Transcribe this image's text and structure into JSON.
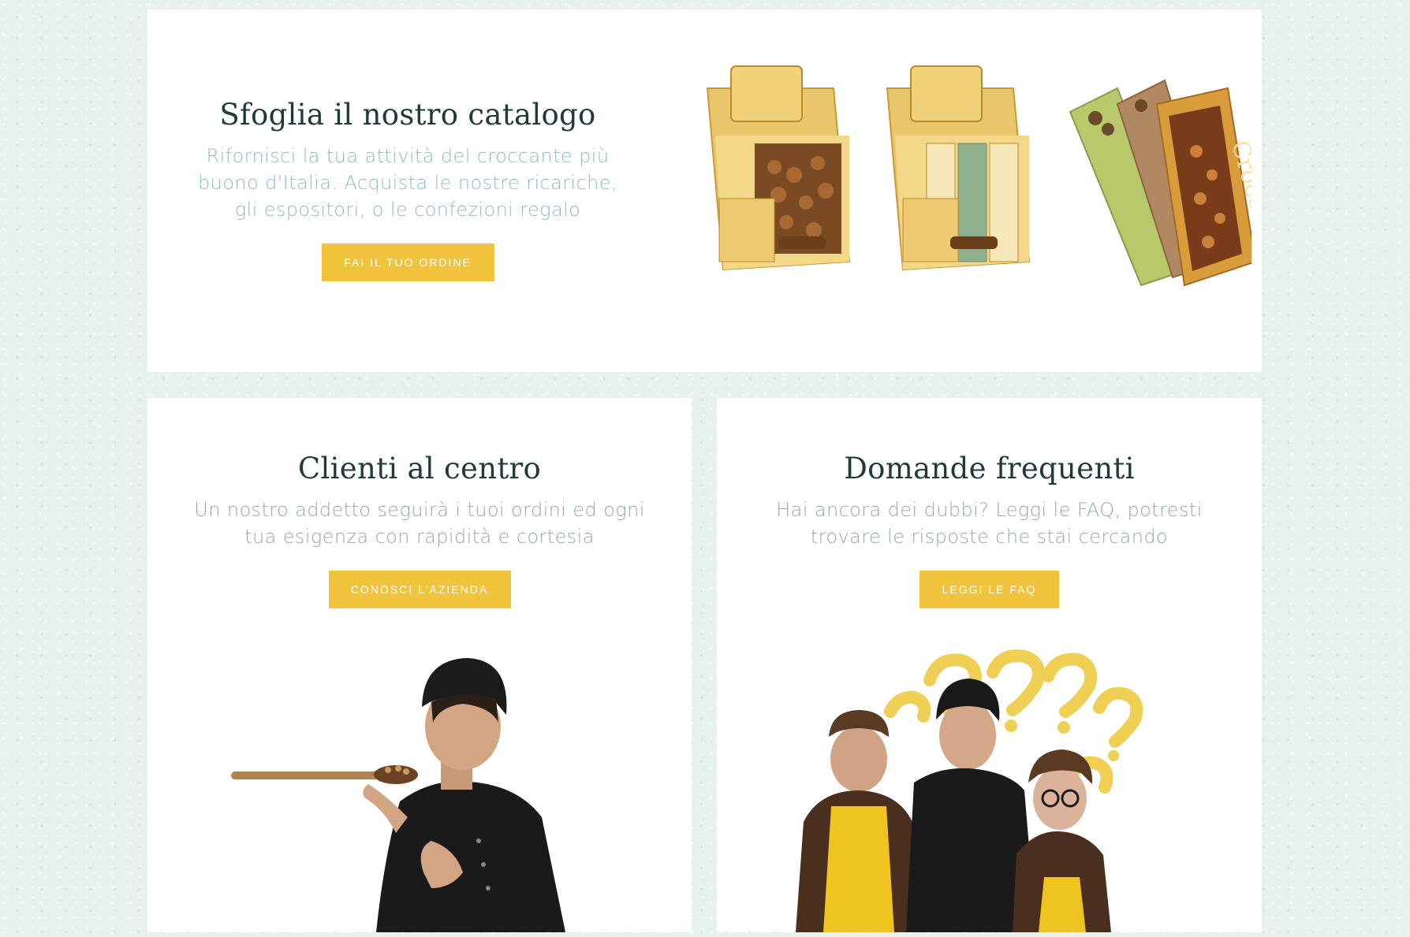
{
  "catalog": {
    "title": "Sfoglia il nostro catalogo",
    "description": "Rifornisci la tua attività del croccante più buono d'Italia. Acquista le nostre ricariche, gli espositori, o le confezioni regalo",
    "button": "FAI IL TUO ORDINE",
    "product_labels": [
      "Croccantone"
    ]
  },
  "clients": {
    "title": "Clienti al centro",
    "description": "Un nostro addetto seguirà i tuoi ordini ed ogni tua esigenza con rapidità e cortesia",
    "button": "CONOSCI L'AZIENDA"
  },
  "faq": {
    "title": "Domande frequenti",
    "description": "Hai ancora dei dubbi? Leggi le FAQ, potresti trovare le risposte che stai cercando",
    "button": "LEGGI LE FAQ"
  },
  "colors": {
    "background": "#e6f1f0",
    "card": "#ffffff",
    "accent_button": "#f2c43d",
    "heading": "#1f3a38",
    "teal_text": "#8fbfbb",
    "grey_text": "#9aa9a7"
  }
}
